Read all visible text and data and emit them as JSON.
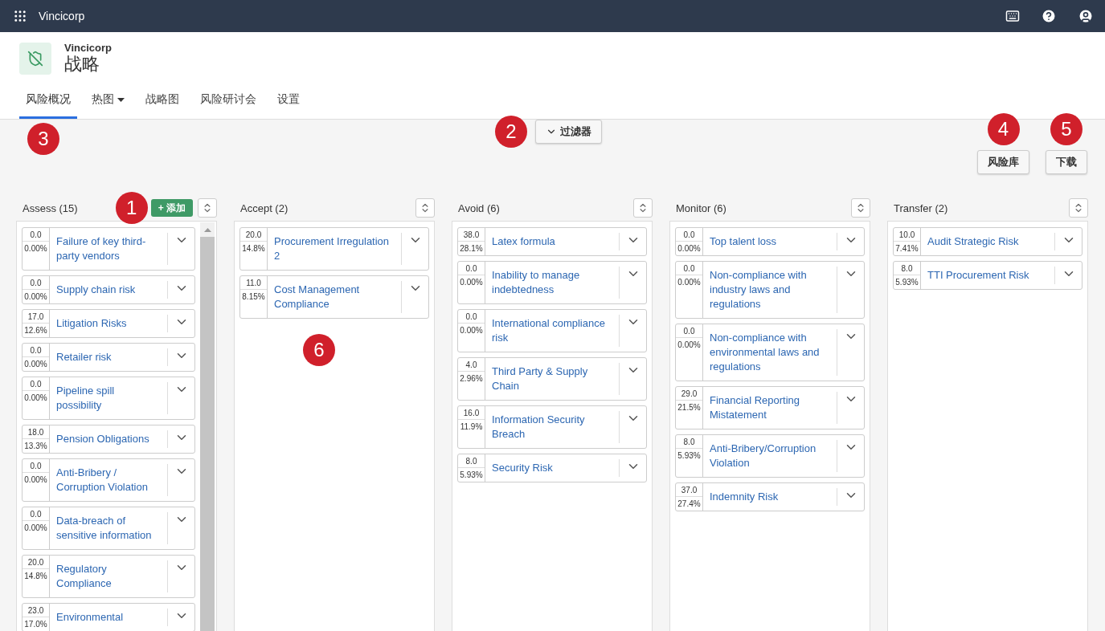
{
  "topbar": {
    "app_name": "Vincicorp"
  },
  "header": {
    "org": "Vincicorp",
    "title": "战略"
  },
  "tabs": [
    {
      "label": "风险概况",
      "selected": true,
      "dropdown": false,
      "callout": "3"
    },
    {
      "label": "热图",
      "selected": false,
      "dropdown": true
    },
    {
      "label": "战略图",
      "selected": false,
      "dropdown": false
    },
    {
      "label": "风险研讨会",
      "selected": false,
      "dropdown": false
    },
    {
      "label": "设置",
      "selected": false,
      "dropdown": false
    }
  ],
  "filter_button": {
    "label": "过滤器",
    "callout": "2"
  },
  "actions": [
    {
      "label": "风险库",
      "callout": "4"
    },
    {
      "label": "下载",
      "callout": "5"
    }
  ],
  "columns": [
    {
      "title": "Assess (15)",
      "add_button": {
        "label": "+ 添加",
        "callout": "1"
      },
      "scrollbar": true,
      "cards": [
        {
          "score": "0.0",
          "percent": "0.00%",
          "name": "Failure of key third-party vendors"
        },
        {
          "score": "0.0",
          "percent": "0.00%",
          "name": "Supply chain risk"
        },
        {
          "score": "17.0",
          "percent": "12.6%",
          "name": "Litigation Risks"
        },
        {
          "score": "0.0",
          "percent": "0.00%",
          "name": "Retailer risk"
        },
        {
          "score": "0.0",
          "percent": "0.00%",
          "name": "Pipeline spill possibility"
        },
        {
          "score": "18.0",
          "percent": "13.3%",
          "name": "Pension Obligations"
        },
        {
          "score": "0.0",
          "percent": "0.00%",
          "name": "Anti-Bribery / Corruption Violation"
        },
        {
          "score": "0.0",
          "percent": "0.00%",
          "name": "Data-breach of sensitive information"
        },
        {
          "score": "20.0",
          "percent": "14.8%",
          "name": "Regulatory Compliance"
        },
        {
          "score": "23.0",
          "percent": "17.0%",
          "name": "Environmental"
        }
      ]
    },
    {
      "title": "Accept (2)",
      "scrollbar": false,
      "callout": "6",
      "cards": [
        {
          "score": "20.0",
          "percent": "14.8%",
          "name": "Procurement Irregulation 2"
        },
        {
          "score": "11.0",
          "percent": "8.15%",
          "name": "Cost Management Compliance"
        }
      ]
    },
    {
      "title": "Avoid (6)",
      "scrollbar": false,
      "cards": [
        {
          "score": "38.0",
          "percent": "28.1%",
          "name": "Latex formula"
        },
        {
          "score": "0.0",
          "percent": "0.00%",
          "name": "Inability to manage indebtedness"
        },
        {
          "score": "0.0",
          "percent": "0.00%",
          "name": "International compliance risk"
        },
        {
          "score": "4.0",
          "percent": "2.96%",
          "name": "Third Party & Supply Chain"
        },
        {
          "score": "16.0",
          "percent": "11.9%",
          "name": "Information Security Breach"
        },
        {
          "score": "8.0",
          "percent": "5.93%",
          "name": "Security Risk"
        }
      ]
    },
    {
      "title": "Monitor (6)",
      "scrollbar": false,
      "cards": [
        {
          "score": "0.0",
          "percent": "0.00%",
          "name": "Top talent loss"
        },
        {
          "score": "0.0",
          "percent": "0.00%",
          "name": "Non-compliance with industry laws and regulations"
        },
        {
          "score": "0.0",
          "percent": "0.00%",
          "name": "Non-compliance with environmental laws and regulations"
        },
        {
          "score": "29.0",
          "percent": "21.5%",
          "name": "Financial Reporting Mistatement"
        },
        {
          "score": "8.0",
          "percent": "5.93%",
          "name": "Anti-Bribery/Corruption Violation"
        },
        {
          "score": "37.0",
          "percent": "27.4%",
          "name": "Indemnity Risk"
        }
      ]
    },
    {
      "title": "Transfer (2)",
      "scrollbar": false,
      "cards": [
        {
          "score": "10.0",
          "percent": "7.41%",
          "name": "Audit Strategic Risk"
        },
        {
          "score": "8.0",
          "percent": "5.93%",
          "name": "TTI Procurement Risk"
        }
      ]
    }
  ]
}
